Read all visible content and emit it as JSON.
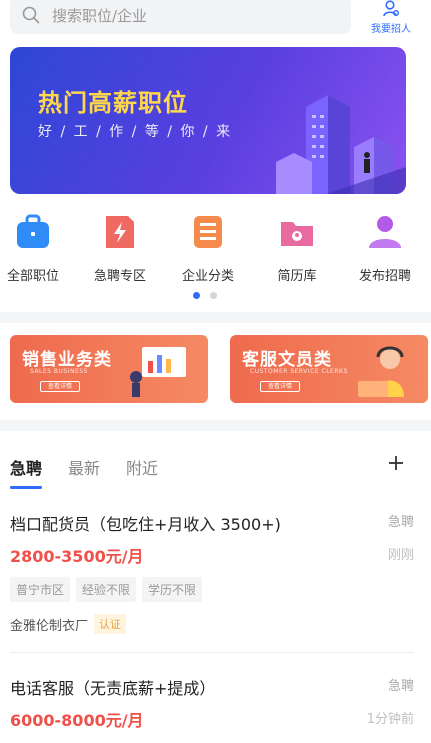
{
  "search": {
    "placeholder": "搜索职位/企业"
  },
  "header": {
    "recruit_label": "我要招人"
  },
  "banner": {
    "title": "热门高薪职位",
    "subtitle": "好 / 工 / 作 / 等 / 你 / 来"
  },
  "quick_nav": [
    {
      "label": "全部职位",
      "icon": "briefcase-icon",
      "color": "#2f8bf5"
    },
    {
      "label": "急聘专区",
      "icon": "lightning-doc-icon",
      "color": "#f06a63"
    },
    {
      "label": "企业分类",
      "icon": "list-icon",
      "color": "#f58a4a"
    },
    {
      "label": "简历库",
      "icon": "folder-icon",
      "color": "#e86aa0"
    },
    {
      "label": "发布招聘",
      "icon": "person-icon",
      "color": "#b35ae8"
    }
  ],
  "promos": [
    {
      "title": "销售业务类",
      "subtitle": "SALES BUSINESS",
      "button": "查看详情"
    },
    {
      "title": "客服文员类",
      "subtitle": "CUSTOMER SERVICE CLERKS",
      "button": "查看详情"
    }
  ],
  "tabs": [
    {
      "label": "急聘"
    },
    {
      "label": "最新"
    },
    {
      "label": "附近"
    }
  ],
  "jobs": [
    {
      "title": "档口配货员（包吃住+月收入 3500+)",
      "tag": "急聘",
      "salary": "2800-3500元/月",
      "time": "刚刚",
      "chips": [
        "普宁市区",
        "经验不限",
        "学历不限"
      ],
      "company": "金雅伦制衣厂",
      "verified": "认证"
    },
    {
      "title": "电话客服（无责底薪+提成）",
      "tag": "急聘",
      "salary": "6000-8000元/月",
      "time": "1分钟前"
    }
  ],
  "colors": {
    "accent": "#2f6bff",
    "salary": "#f0504a",
    "banner_title": "#ffd84a"
  }
}
